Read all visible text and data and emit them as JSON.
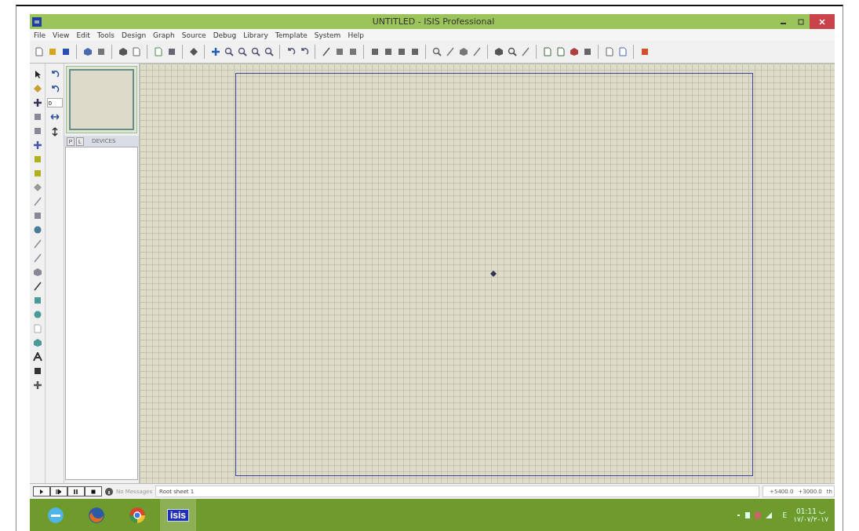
{
  "window": {
    "title": "UNTITLED - ISIS Professional"
  },
  "menu": [
    "File",
    "View",
    "Edit",
    "Tools",
    "Design",
    "Graph",
    "Source",
    "Debug",
    "Library",
    "Template",
    "System",
    "Help"
  ],
  "rotation": {
    "value": "0"
  },
  "device_panel": {
    "tabs": [
      {
        "label": "P",
        "selected": false
      },
      {
        "label": "L",
        "selected": false
      }
    ],
    "title": "DEVICES"
  },
  "status_bar": {
    "message": "No Messages",
    "sheet": "Root sheet 1",
    "x": "+5400.0",
    "y": "+3000.0",
    "unit": "th"
  },
  "taskbar": {
    "apps": [
      {
        "kind": "ie",
        "selected": false
      },
      {
        "kind": "firefox",
        "selected": false
      },
      {
        "kind": "chrome",
        "selected": false
      },
      {
        "kind": "isis",
        "label": "isis",
        "selected": true
      }
    ],
    "language": "E",
    "time": "01:11 ب",
    "date": "۱۷/۰۷/۲۰۱۷"
  }
}
